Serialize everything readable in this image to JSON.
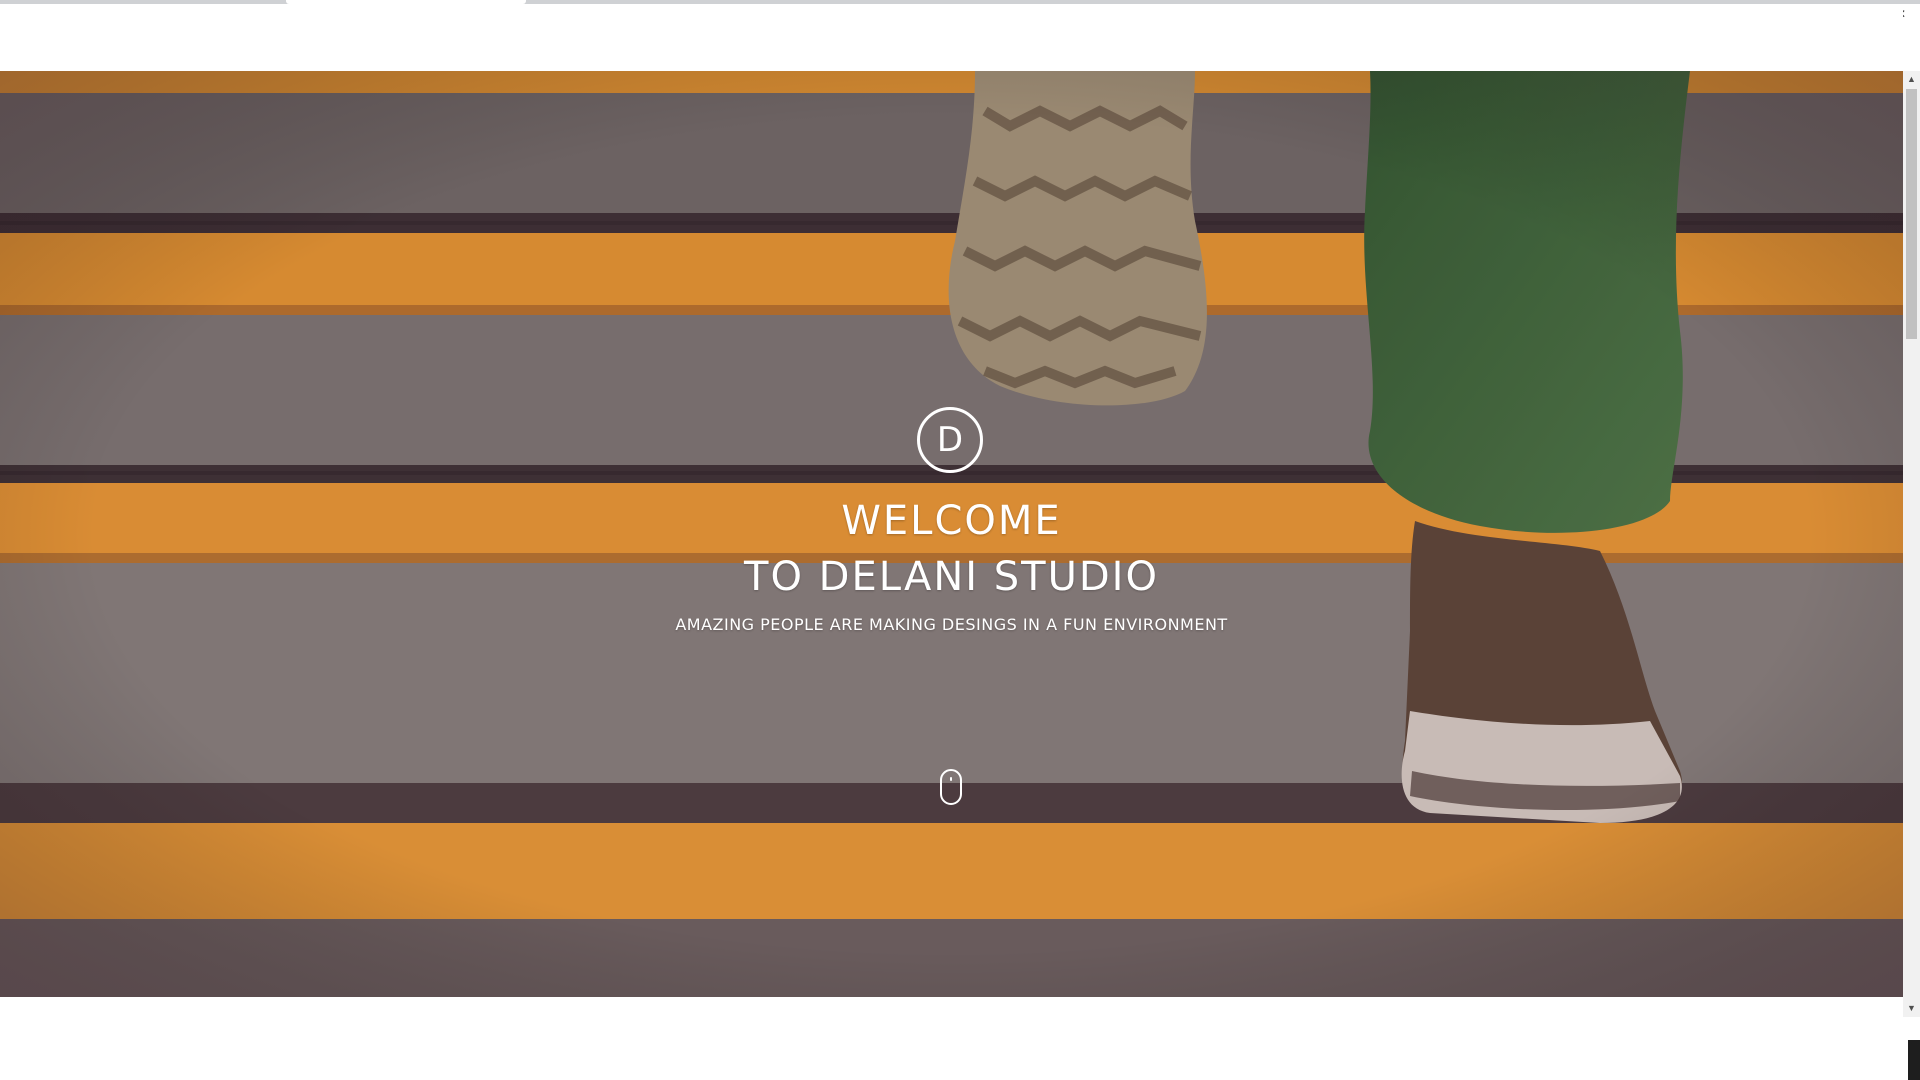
{
  "browser": {
    "close_glyph": "✕"
  },
  "hero": {
    "logo_letter": "D",
    "title_line1": "WELCOME",
    "title_line2": "TO DELANI STUDIO",
    "subtitle": "AMAZING PEOPLE ARE MAKING DESINGS IN A FUN ENVIRONMENT",
    "scroll_icon": "mouse-scroll-icon"
  },
  "scrollbar": {
    "up_arrow": "▲",
    "down_arrow": "▼"
  },
  "colors": {
    "stripe_orange": "#e8982f",
    "step_gray": "#7c7773",
    "dark_edge": "#3a3230",
    "pants_green": "#3f6b3c",
    "shoe_brown": "#5a4636"
  }
}
